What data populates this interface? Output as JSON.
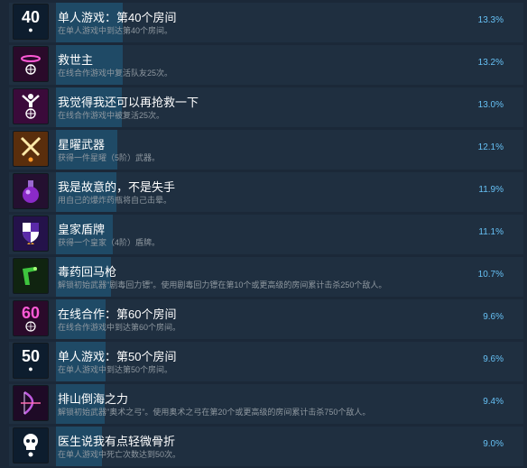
{
  "achievements": [
    {
      "title": "单人游戏：第40个房间",
      "desc": "在单人游戏中到达第40个房间。",
      "percent": "13.3%",
      "icon": "number-40-single-player-icon",
      "pct_value": 13.3
    },
    {
      "title": "救世主",
      "desc": "在线合作游戏中复活队友25次。",
      "percent": "13.2%",
      "icon": "halo-globe-icon",
      "pct_value": 13.2
    },
    {
      "title": "我觉得我还可以再抢救一下",
      "desc": "在线合作游戏中被复活25次。",
      "percent": "13.0%",
      "icon": "rising-figure-globe-icon",
      "pct_value": 13.0
    },
    {
      "title": "星曜武器",
      "desc": "获得一件星曜（5阶）武器。",
      "percent": "12.1%",
      "icon": "crossed-swords-icon",
      "pct_value": 12.1
    },
    {
      "title": "我是故意的，不是失手",
      "desc": "用自己的爆炸药瓶将自己击晕。",
      "percent": "11.9%",
      "icon": "potion-flask-icon",
      "pct_value": 11.9
    },
    {
      "title": "皇家盾牌",
      "desc": "获得一个皇家（4阶）盾牌。",
      "percent": "11.1%",
      "icon": "shield-crown-icon",
      "pct_value": 11.1
    },
    {
      "title": "毒药回马枪",
      "desc": "解锁初始武器\"剧毒回力镖\"。使用剧毒回力镖在第10个或更高级的房间累计击杀250个敌人。",
      "percent": "10.7%",
      "icon": "poison-boomerang-icon",
      "pct_value": 10.7
    },
    {
      "title": "在线合作：第60个房间",
      "desc": "在线合作游戏中到达第60个房间。",
      "percent": "9.6%",
      "icon": "number-60-online-icon",
      "pct_value": 9.6
    },
    {
      "title": "单人游戏：第50个房间",
      "desc": "在单人游戏中到达第50个房间。",
      "percent": "9.6%",
      "icon": "number-50-single-player-icon",
      "pct_value": 9.6
    },
    {
      "title": "排山倒海之力",
      "desc": "解锁初始武器\"奥术之弓\"。使用奥术之弓在第20个或更高级的房间累计击杀750个敌人。",
      "percent": "9.4%",
      "icon": "arcane-bow-icon",
      "pct_value": 9.4
    },
    {
      "title": "医生说我有点轻微骨折",
      "desc": "在单人游戏中死亡次数达到50次。",
      "percent": "9.0%",
      "icon": "skull-single-player-icon",
      "pct_value": 9.0
    }
  ],
  "colors": {
    "background": "#1b2838",
    "row": "#1f2f40",
    "progress": "#1f4a66",
    "percent_text": "#66c0f4"
  }
}
